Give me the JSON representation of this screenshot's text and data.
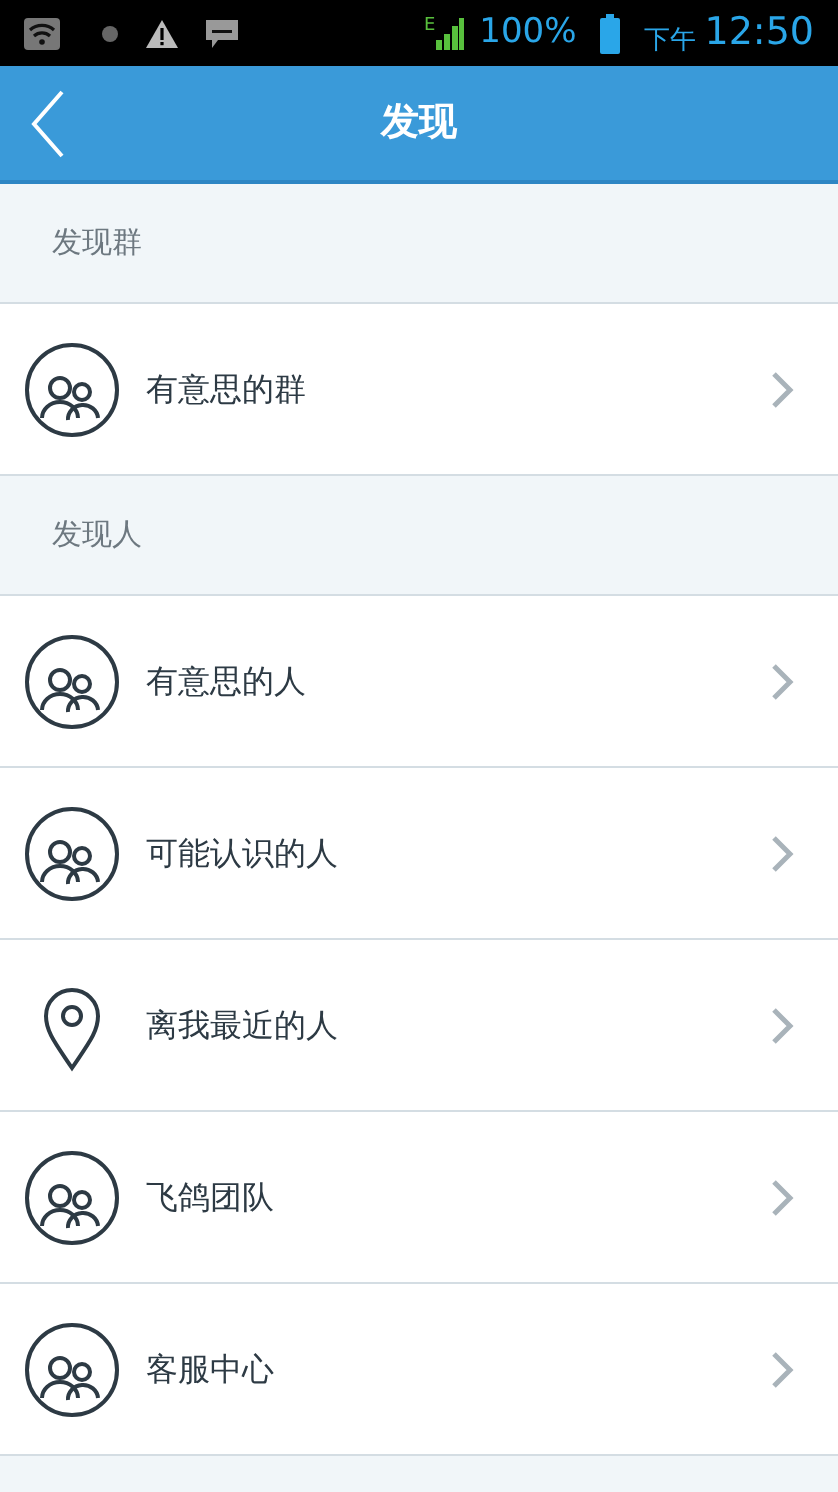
{
  "status_bar": {
    "network": "E",
    "battery": "100%",
    "period": "下午",
    "time": "12:50"
  },
  "header": {
    "title": "发现"
  },
  "sections": [
    {
      "title": "发现群",
      "items": [
        {
          "label": "有意思的群",
          "kind": "group"
        }
      ]
    },
    {
      "title": "发现人",
      "items": [
        {
          "label": "有意思的人",
          "kind": "group"
        },
        {
          "label": "可能认识的人",
          "kind": "group"
        },
        {
          "label": "离我最近的人",
          "kind": "location"
        },
        {
          "label": "飞鸽团队",
          "kind": "group"
        },
        {
          "label": "客服中心",
          "kind": "group"
        }
      ]
    }
  ]
}
